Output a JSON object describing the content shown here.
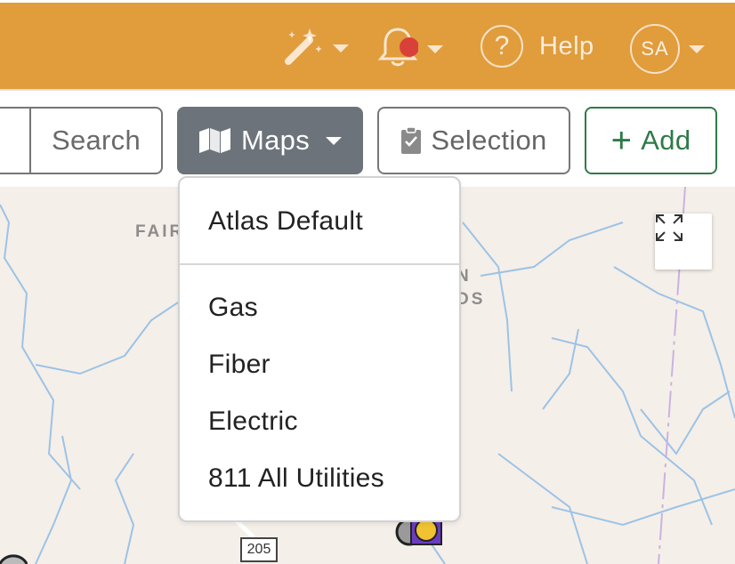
{
  "header": {
    "help_label": "Help",
    "help_glyph": "?",
    "avatar_initials": "SA",
    "notification_dot_color": "#d9403a"
  },
  "toolbar": {
    "search_label": "Search",
    "maps_label": "Maps",
    "selection_label": "Selection",
    "add_label": "Add",
    "add_glyph": "+"
  },
  "map": {
    "labels": [
      "FAIR",
      "N",
      "DS"
    ],
    "road_shield": "205"
  },
  "maps_menu": {
    "items": [
      "Atlas Default",
      "Gas",
      "Fiber",
      "Electric",
      "811 All Utilities"
    ]
  },
  "colors": {
    "header": "#e19c3c",
    "maps_button": "#6c737a",
    "add_button": "#2f7a48",
    "map_background": "#f5efe9",
    "water": "#9cc3e6"
  },
  "icons": [
    "magic-wand-icon",
    "bell-icon",
    "question-circle-icon",
    "map-icon",
    "clipboard-check-icon",
    "plus-icon",
    "fullscreen-expand-icon",
    "caret-down-icon"
  ]
}
